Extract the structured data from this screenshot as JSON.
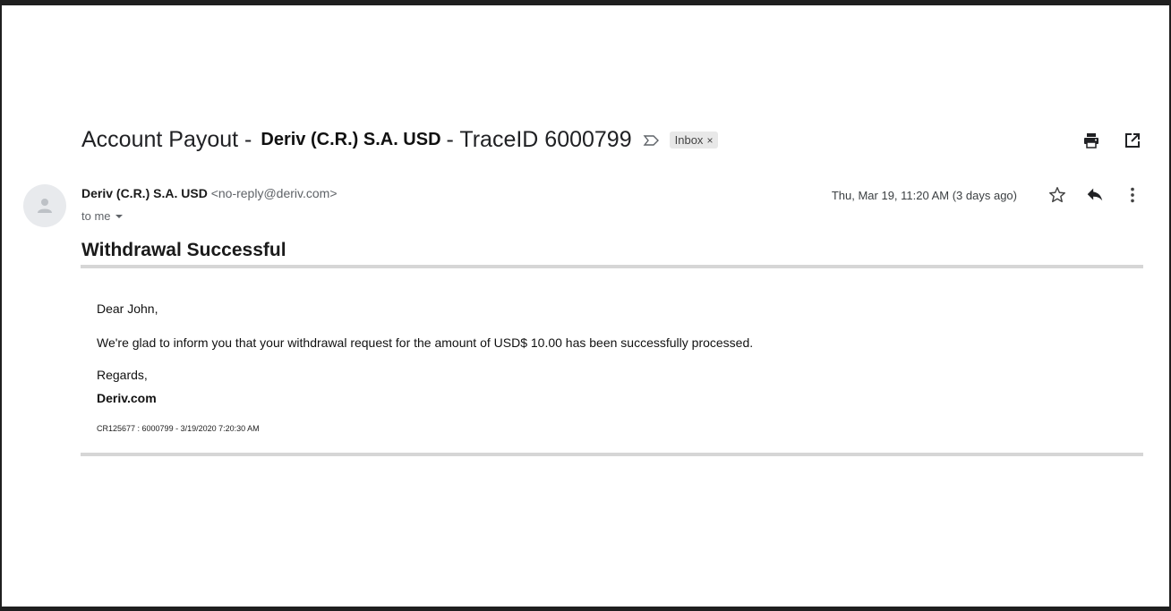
{
  "email": {
    "subject_prefix": "Account Payout -",
    "subject_sender": "Deriv (C.R.) S.A. USD",
    "subject_suffix": "- TraceID 6000799",
    "label": "Inbox",
    "label_close": "×",
    "sender_name": "Deriv (C.R.) S.A. USD",
    "sender_email": "<no-reply@deriv.com>",
    "recipient": "to me",
    "date": "Thu, Mar 19, 11:20 AM (3 days ago)"
  },
  "body": {
    "title": "Withdrawal Successful",
    "greeting": "Dear John,",
    "message": "We're glad to inform you that your withdrawal request for the amount of USD$ 10.00 has been successfully processed.",
    "regards": "Regards,",
    "signature": "Deriv.com",
    "reference": "CR125677 : 6000799 - 3/19/2020 7:20:30 AM"
  },
  "icons": {
    "important": "important-marker-icon",
    "print": "print-icon",
    "new_window": "open-in-new-window-icon",
    "star": "star-icon",
    "reply": "reply-icon",
    "more": "more-vert-icon",
    "avatar": "person-icon",
    "dropdown": "chevron-down-icon"
  }
}
